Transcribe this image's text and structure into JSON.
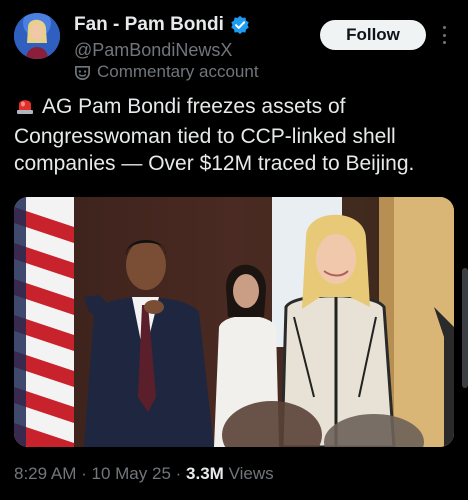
{
  "author": {
    "display_name": "Fan - Pam Bondi",
    "handle": "@PamBondiNewsX",
    "label": "Commentary account",
    "label_icon": "parody-mask-icon",
    "verified_icon": "verified-badge-icon"
  },
  "actions": {
    "follow_label": "Follow",
    "more_icon": "more-vertical-icon"
  },
  "post": {
    "emoji": "🚨",
    "text": "AG Pam Bondi freezes assets of Congresswoman tied to CCP-linked shell companies — Over $12M traced to Beijing."
  },
  "meta": {
    "time": "8:29 AM",
    "separator": "·",
    "date": "10 May 25",
    "views_count": "3.3M",
    "views_label": "Views"
  },
  "colors": {
    "background": "#000000",
    "text": "#e7e9ea",
    "secondary_text": "#71767b",
    "verified_blue": "#1d9bf0",
    "follow_bg": "#eff3f4"
  }
}
